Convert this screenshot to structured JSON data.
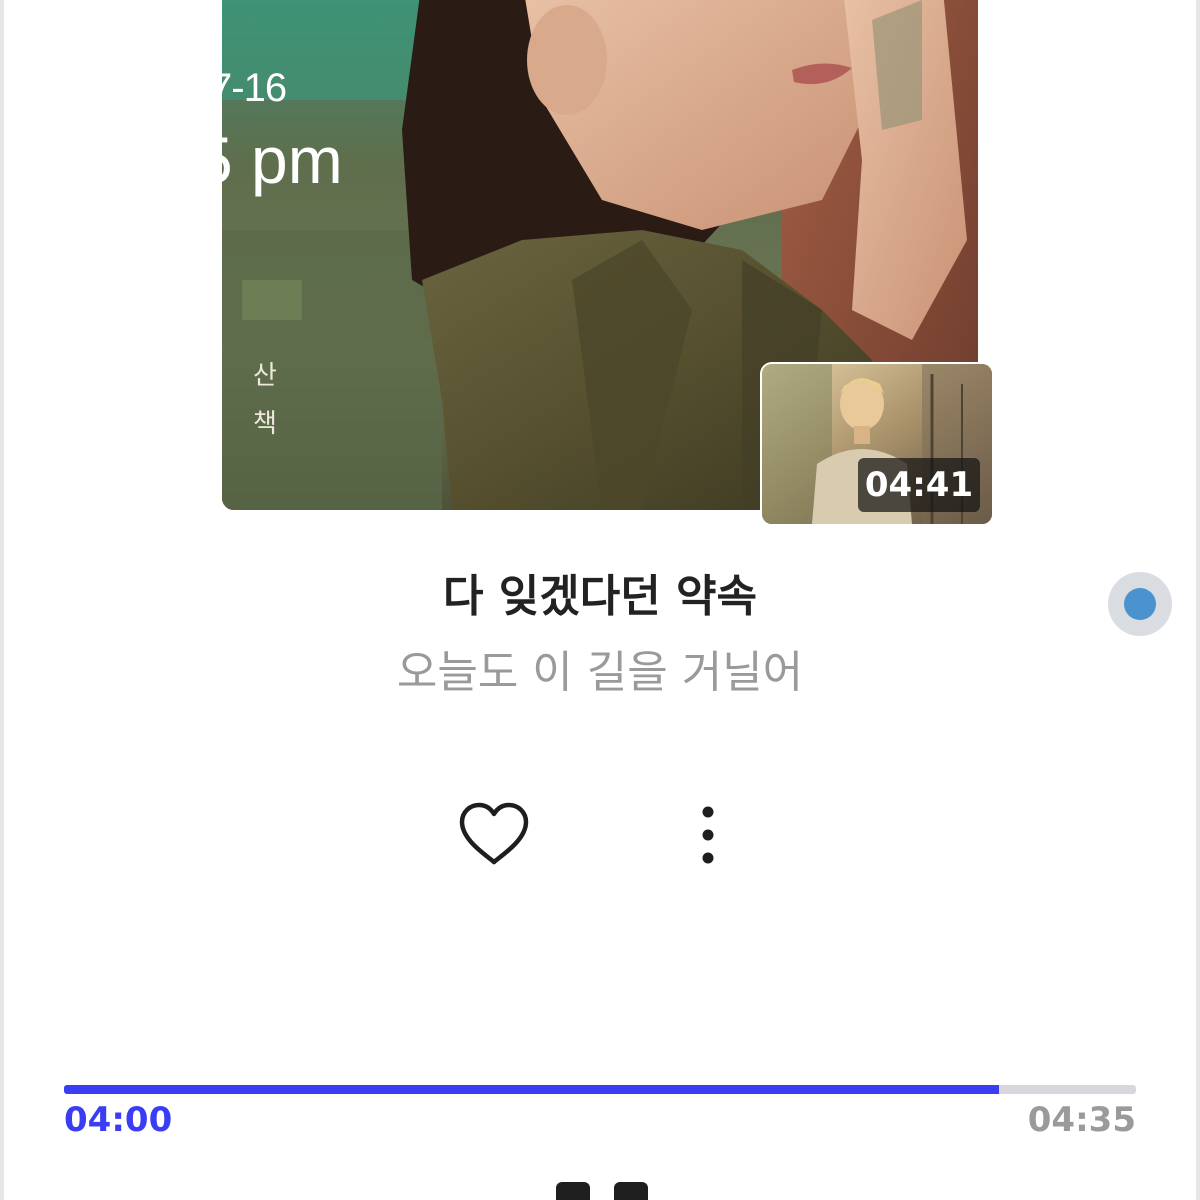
{
  "album": {
    "date_overlay": "7-16",
    "time_overlay": "5 pm",
    "vertical_text": [
      "산",
      "책"
    ]
  },
  "video": {
    "duration": "04:41"
  },
  "track": {
    "title": "다 잊겠다던 약속",
    "lyric": "오늘도 이 길을 거닐어"
  },
  "actions": {
    "like_icon": "heart-outline-icon",
    "more_icon": "more-vertical-icon"
  },
  "floating": {
    "icon": "floating-assist-dot",
    "color": "#4a93cf"
  },
  "player": {
    "current_time": "04:00",
    "total_time": "04:35",
    "progress": 0.872,
    "accent_color": "#3a3df2"
  }
}
